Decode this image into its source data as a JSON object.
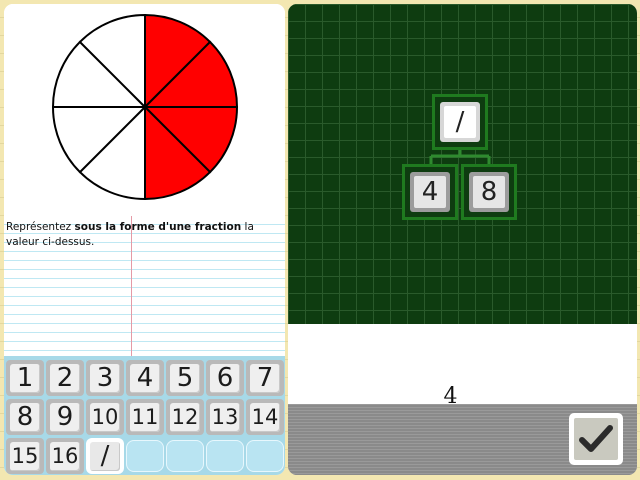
{
  "question": {
    "prompt_before": "Représentez ",
    "prompt_bold": "sous la forme d'une fraction",
    "prompt_after": " la valeur ci-dessus."
  },
  "pie": {
    "total_slices": 8,
    "shaded_slices": 4,
    "shade_color": "#ff0000",
    "empty_color": "#ffffff"
  },
  "keypad": {
    "keys": [
      "1",
      "2",
      "3",
      "4",
      "5",
      "6",
      "7",
      "8",
      "9",
      "10",
      "11",
      "12",
      "13",
      "14",
      "15",
      "16",
      "/",
      "",
      "",
      "",
      "",
      ""
    ]
  },
  "board": {
    "top_tile": "/",
    "left_tile": "4",
    "right_tile": "8"
  },
  "answer": {
    "value": "4"
  },
  "submit": {
    "icon": "checkmark-icon"
  }
}
